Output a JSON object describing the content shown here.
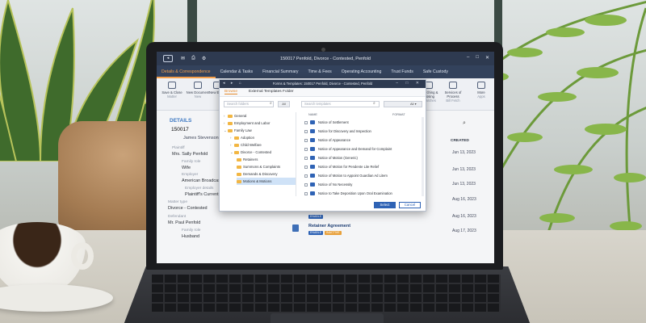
{
  "colors": {
    "titlebar": "#2e3a50",
    "menubar": "#33425c",
    "accent": "#f6a04b",
    "primary_button": "#2f63b5",
    "detail_heading": "#3d78c2"
  },
  "window": {
    "title": "150017 Penfold, Divorce - Contested, Penfold",
    "controls": [
      "–",
      "□",
      "✕"
    ]
  },
  "menu": {
    "items": [
      {
        "label": "Details & Correspondence",
        "active": true
      },
      {
        "label": "Calendar & Tasks"
      },
      {
        "label": "Financial Summary"
      },
      {
        "label": "Time & Fees"
      },
      {
        "label": "Operating Accounting"
      },
      {
        "label": "Trust Funds"
      },
      {
        "label": "Safe Custody"
      }
    ]
  },
  "ribbon": {
    "save_close": "Save & Close",
    "group_matter": "Matter",
    "new_document": "New Document",
    "new_email": "New Email",
    "group_new": "New",
    "searching_closing": "Searching & Closing",
    "searches": "Searches",
    "services": "Services of Process",
    "group_services": "Bill Fetch",
    "more": "More",
    "apps": "Apps"
  },
  "details": {
    "heading": "DETAILS",
    "matter_number": "150017",
    "client": "James Stevenson, Samant",
    "plaintiff_label": "Plaintiff",
    "plaintiff": "Mrs. Sally Penfold",
    "family_role_label": "Family role",
    "family_role": "Wife",
    "employer_label": "Employer",
    "employer": "American Broadcasti",
    "employer_details_label": "Employer details",
    "employer_details": "Plaintiff's Current E",
    "matter_type_label": "Matter type",
    "matter_type": "Divorce - Contested",
    "defendant_label": "Defendant",
    "defendant": "Mr. Paul Penfold",
    "def_family_role_label": "Family role",
    "def_family_role": "Husband"
  },
  "main_list": {
    "created_header": "CREATED",
    "dates": [
      "Jun 13, 2023",
      "Jun 13, 2023",
      "Jun 13, 2023",
      "Aug 16, 2023",
      "Aug 16, 2023",
      "Aug 17, 2023"
    ],
    "docs": [
      {
        "title": "",
        "badges": [
          "ENABLE"
        ]
      },
      {
        "title": "Retainer Agreement",
        "badges": [
          "ENABLE",
          "INACTIVE"
        ]
      }
    ]
  },
  "dialog": {
    "title": "Forms & Templates: 150017 Penfold, Divorce - Contested, Penfold",
    "tabs": [
      "Browse",
      "External Templates Folder"
    ],
    "search_folders_placeholder": "Search folders",
    "search_templates_placeholder": "Search templates",
    "all_chip": "All",
    "all_select": "All",
    "tree": [
      {
        "label": "General",
        "level": 0
      },
      {
        "label": "Employment and Labor",
        "level": 0
      },
      {
        "label": "Family Law",
        "level": 0,
        "open": true
      },
      {
        "label": "Adoption",
        "level": 1
      },
      {
        "label": "Child Welfare",
        "level": 1
      },
      {
        "label": "Divorce - Contested",
        "level": 1,
        "open": true
      },
      {
        "label": "Retainers",
        "level": 2
      },
      {
        "label": "Summons & Complaints",
        "level": 2
      },
      {
        "label": "Demands & Discovery",
        "level": 2
      },
      {
        "label": "Motions & Motions",
        "level": 2,
        "selected": true
      }
    ],
    "list_header_name": "NAME",
    "list_header_format": "FORMAT",
    "templates": [
      "Notice of Settlement",
      "Notice for Discovery and Inspection",
      "Notice of Appearance",
      "Notice of Appearance and Demand for Complaint",
      "Notice of Motion (Generic)",
      "Notice of Motion for Pendente Lite Relief",
      "Notice of Motion to Appoint Guardian Ad Litem",
      "Notice of No Necessity",
      "Notice to Take Deposition Upon Oral Examination"
    ],
    "select_label": "Select",
    "cancel_label": "Cancel"
  }
}
